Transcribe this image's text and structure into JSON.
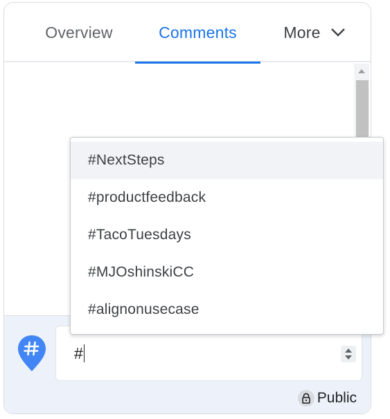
{
  "tabs": {
    "overview": "Overview",
    "comments": "Comments",
    "more": "More"
  },
  "dropdown": {
    "items": [
      "#NextSteps",
      "#productfeedback",
      "#TacoTuesdays",
      "#MJOshinskiCC",
      "#alignonusecase"
    ],
    "highlighted_index": 0
  },
  "composer": {
    "input_value": "#",
    "visibility_label": "Public"
  },
  "colors": {
    "accent": "#1a73e8",
    "composer_bg": "#edf2fa",
    "pin_blue": "#4285f4"
  },
  "icons": {
    "more_chevron": "chevron-down-icon",
    "hashtag_pin": "hashtag-pin-icon",
    "lock": "lock-icon"
  }
}
